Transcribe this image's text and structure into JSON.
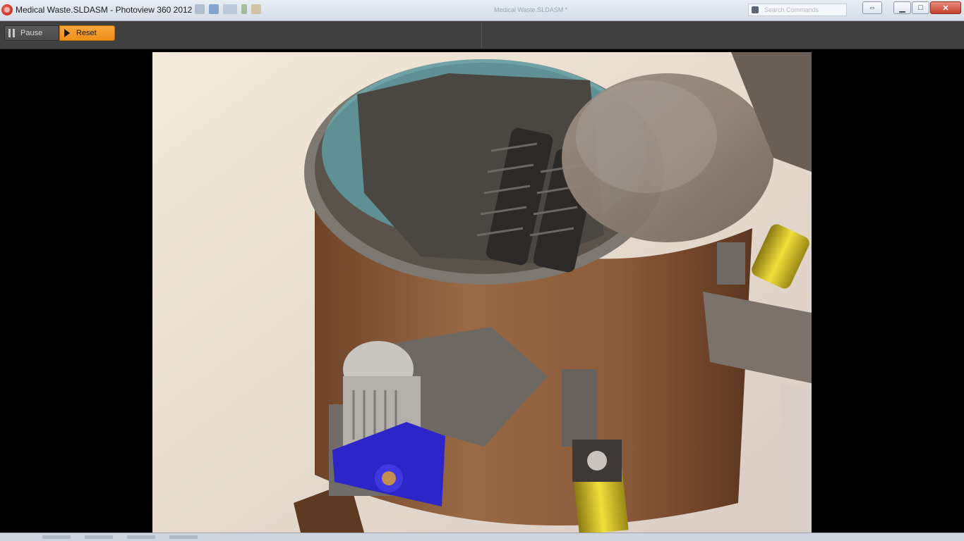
{
  "window": {
    "title": "Medical Waste.SLDASM - Photoview 360 2012",
    "ghost_title": "Medical Waste.SLDASM *",
    "search_placeholder": "Search Commands",
    "controls": {
      "resize": "⇔",
      "minimize": "▁",
      "maximize": "□",
      "close": "✕"
    }
  },
  "render_toolbar": {
    "pause_label": "Pause",
    "reset_label": "Reset"
  },
  "colors": {
    "reset_accent": "#f0961f",
    "tank_wood": "#8b5a38",
    "motor_blue": "#2c26c8",
    "cylinder_yellow": "#e3d12a"
  },
  "icons": [
    "app-logo-icon",
    "pause-icon",
    "play-icon",
    "search-icon"
  ]
}
